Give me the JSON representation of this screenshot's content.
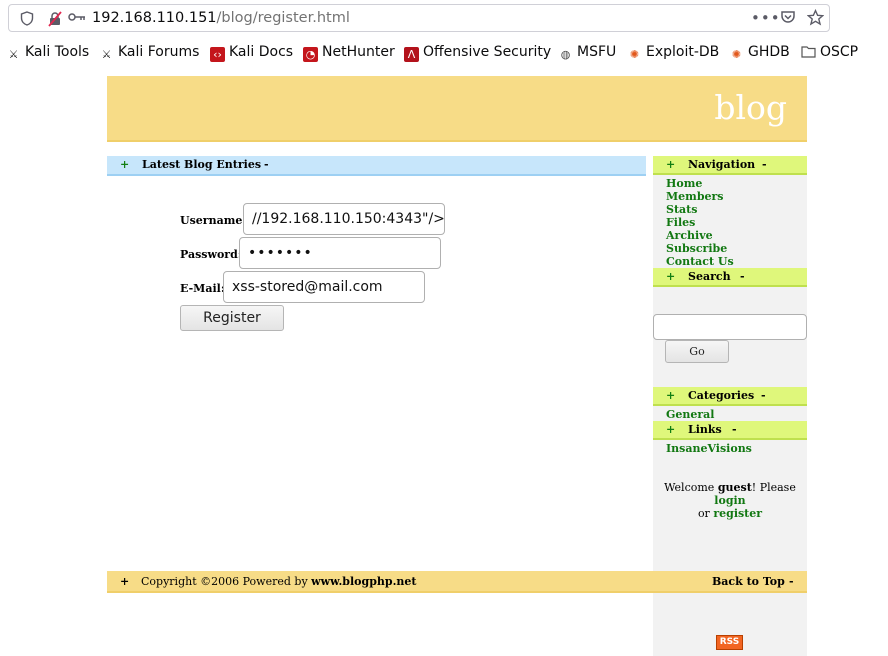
{
  "browser": {
    "url_host": "192.168.110.151",
    "url_path": "/blog/register.html",
    "bookmarks": [
      {
        "label": "Kali Tools",
        "icon": "kali-dragon-icon"
      },
      {
        "label": "Kali Forums",
        "icon": "kali-dragon-icon"
      },
      {
        "label": "Kali Docs",
        "icon": "kali-docs-icon"
      },
      {
        "label": "NetHunter",
        "icon": "nethunter-icon"
      },
      {
        "label": "Offensive Security",
        "icon": "offsec-icon"
      },
      {
        "label": "MSFU",
        "icon": "globe-icon"
      },
      {
        "label": "Exploit-DB",
        "icon": "exploit-db-icon"
      },
      {
        "label": "GHDB",
        "icon": "ghdb-icon"
      },
      {
        "label": "OSCP",
        "icon": "folder-icon"
      }
    ]
  },
  "header": {
    "title": "blog"
  },
  "main": {
    "section_label": "Latest Blog Entries",
    "plus": "+",
    "minus": "-",
    "form": {
      "username_label": "Username:",
      "username_value": "//192.168.110.150:4343\"/>",
      "password_label": "Password:",
      "password_value": "•••••••",
      "email_label": "E-Mail:",
      "email_value": "xss-stored@mail.com",
      "register_label": "Register"
    }
  },
  "sidebar": {
    "navigation_label": "Navigation",
    "nav_items": [
      "Home",
      "Members",
      "Stats",
      "Files",
      "Archive",
      "Subscribe",
      "Contact Us"
    ],
    "search_label": "Search",
    "search_button": "Go",
    "search_value": "",
    "categories_label": "Categories",
    "categories": [
      "General"
    ],
    "links_label": "Links",
    "links": [
      "InsaneVisions"
    ],
    "welcome_prefix": "Welcome ",
    "welcome_user": "guest",
    "welcome_mid": "! Please ",
    "login_label": "login",
    "or_label": "or ",
    "register_label": "register",
    "rss_label": "RSS"
  },
  "footer": {
    "copyright": "Copyright ©2006 Powered by ",
    "powered_link": "www.blogphp.net",
    "back_to_top": "Back to Top"
  },
  "colors": {
    "header_bg": "#f7dc87",
    "entries_bar_bg": "#c7e6fb",
    "sidebar_bar_bg": "#dff77b",
    "link_green": "#127812"
  }
}
